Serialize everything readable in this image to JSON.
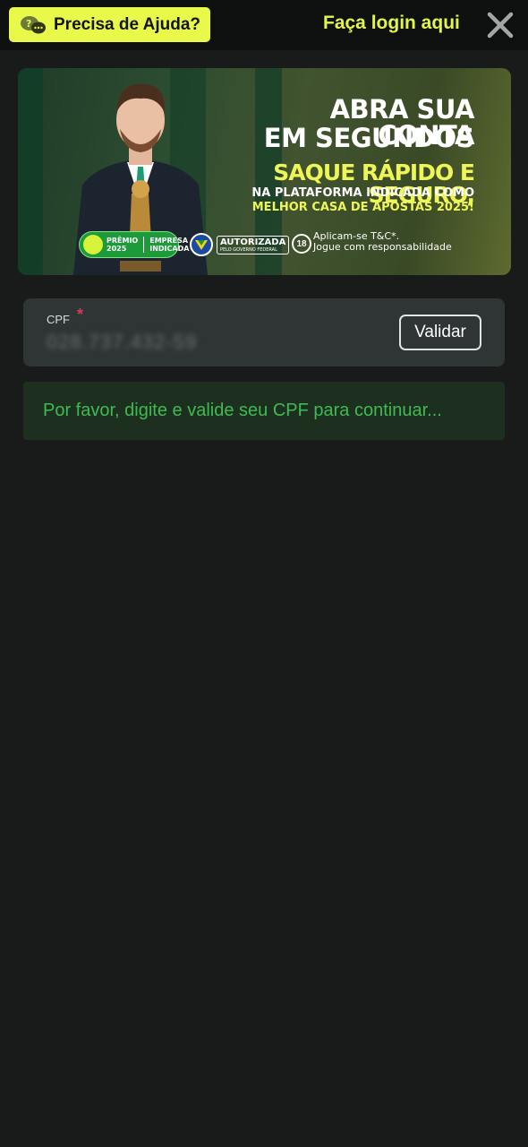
{
  "header": {
    "help_label": "Precisa de Ajuda?",
    "login_label": "Faça login aqui",
    "close_icon": "close-icon",
    "help_icon": "chat-question-icon"
  },
  "banner": {
    "headline_1": "ABRA SUA CONTA",
    "headline_2": "EM SEGUNDOS",
    "sub_1": "SAQUE RÁPIDO E SEGURO,",
    "sub_2": "NA PLATAFORMA INDICADA COMO",
    "sub_3": "MELHOR CASA DE APOSTAS 2025!",
    "badge_premio_1": "PRÊMIO",
    "badge_premio_2": "2025",
    "badge_empresa_1": "EMPRESA",
    "badge_empresa_2": "INDICADA",
    "badge_auth_1": "AUTORIZADA",
    "badge_auth_2": "PELO GOVERNO FEDERAL",
    "badge_age": "18",
    "resp_1": "Aplicam-se T&C*.",
    "resp_2": "Jogue com responsabilidade"
  },
  "cpf": {
    "label": "CPF",
    "required_mark": "*",
    "value": "028.737.432-59",
    "validate_label": "Validar"
  },
  "notice": {
    "text": "Por favor, digite e valide seu CPF para continuar..."
  },
  "colors": {
    "accent": "#e8f94a",
    "background": "#181b1a",
    "notice_text": "#3fba52",
    "required": "#d23c57"
  }
}
